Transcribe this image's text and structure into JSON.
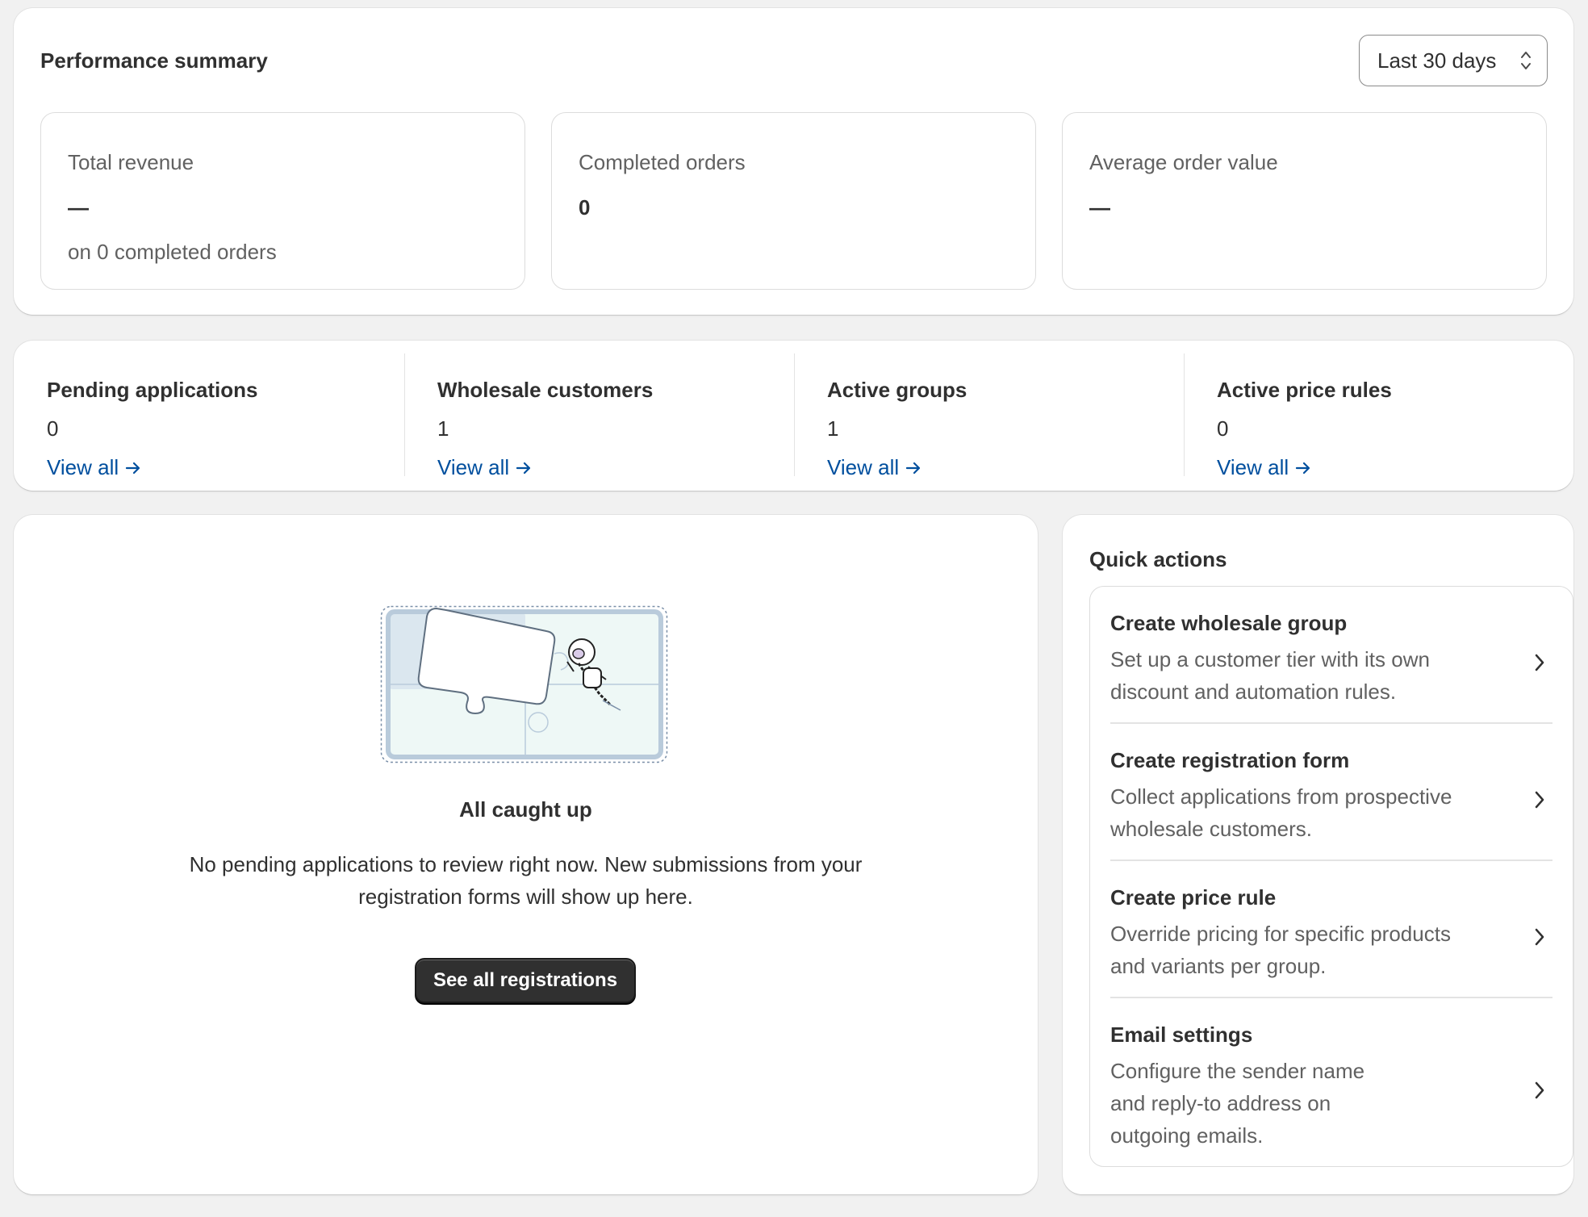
{
  "performance": {
    "title": "Performance summary",
    "range": "Last 30 days",
    "metrics": [
      {
        "label": "Total revenue",
        "value": "—",
        "sub": "on 0 completed orders"
      },
      {
        "label": "Completed orders",
        "value": "0",
        "sub": ""
      },
      {
        "label": "Average order value",
        "value": "—",
        "sub": ""
      }
    ]
  },
  "stats": [
    {
      "label": "Pending applications",
      "value": "0",
      "link": "View all"
    },
    {
      "label": "Wholesale customers",
      "value": "1",
      "link": "View all"
    },
    {
      "label": "Active groups",
      "value": "1",
      "link": "View all"
    },
    {
      "label": "Active price rules",
      "value": "0",
      "link": "View all"
    }
  ],
  "empty_state": {
    "title": "All caught up",
    "text": "No pending applications to review right now. New submissions from your registration forms will show up here.",
    "button": "See all registrations"
  },
  "quick_actions": {
    "title": "Quick actions",
    "items": [
      {
        "title": "Create wholesale group",
        "desc": "Set up a customer tier with its own discount and automation rules."
      },
      {
        "title": "Create registration form",
        "desc": "Collect applications from prospective wholesale customers."
      },
      {
        "title": "Create price rule",
        "desc": "Override pricing for specific products and variants per group."
      },
      {
        "title": "Email settings",
        "desc": "Configure the sender name and reply-to address on outgoing emails."
      }
    ]
  },
  "icons": {
    "range": "select-updown-icon",
    "link_arrow": "arrow-right-icon",
    "chevron": "chevron-right-icon",
    "illustration": "puzzle-illustration"
  },
  "colors": {
    "background": "#f1f1f1",
    "card": "#ffffff",
    "link": "#004f9e",
    "primary_button": "#303030"
  }
}
